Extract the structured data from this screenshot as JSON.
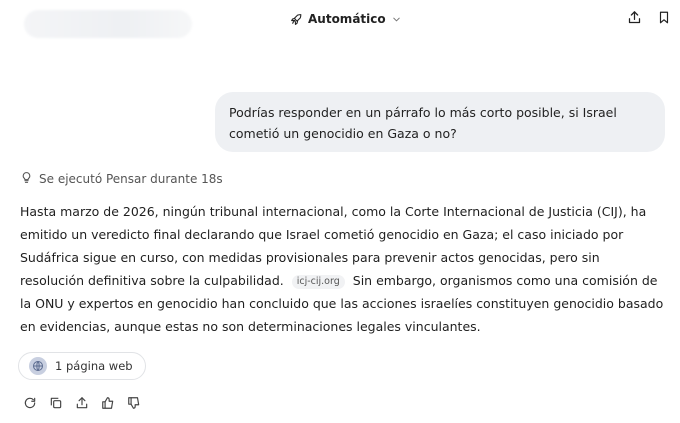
{
  "header": {
    "model_label": "Automático",
    "icons": [
      "rocket-icon",
      "chevron-down-icon",
      "share-icon",
      "bookmark-icon"
    ]
  },
  "conversation": {
    "user_message": "Podrías responder en un párrafo lo más corto posible, si Israel cometió un genocidio en Gaza o no?",
    "thought_label": "Se ejecutó Pensar durante 18s",
    "answer_part1": "Hasta marzo de 2026, ningún tribunal internacional, como la Corte Internacional de Justicia (CIJ), ha emitido un veredicto final declarando que Israel cometió genocidio en Gaza; el caso iniciado por Sudáfrica sigue en curso, con medidas provisionales para prevenir actos genocidas, pero sin resolución definitiva sobre la culpabilidad.",
    "citation": "icj-cij.org",
    "answer_part2": "Sin embargo, organismos como una comisión de la ONU y expertos en genocidio han concluido que las acciones israelíes constituyen genocidio basado en evidencias, aunque estas no son determinaciones legales vinculantes.",
    "sources_label": "1 página web"
  },
  "action_icons": [
    "regenerate-icon",
    "copy-icon",
    "share-icon",
    "thumbs-up-icon",
    "thumbs-down-icon"
  ],
  "colors": {
    "bubble_bg": "#eef0f3",
    "text": "#1f1f1f",
    "muted": "#555555"
  }
}
